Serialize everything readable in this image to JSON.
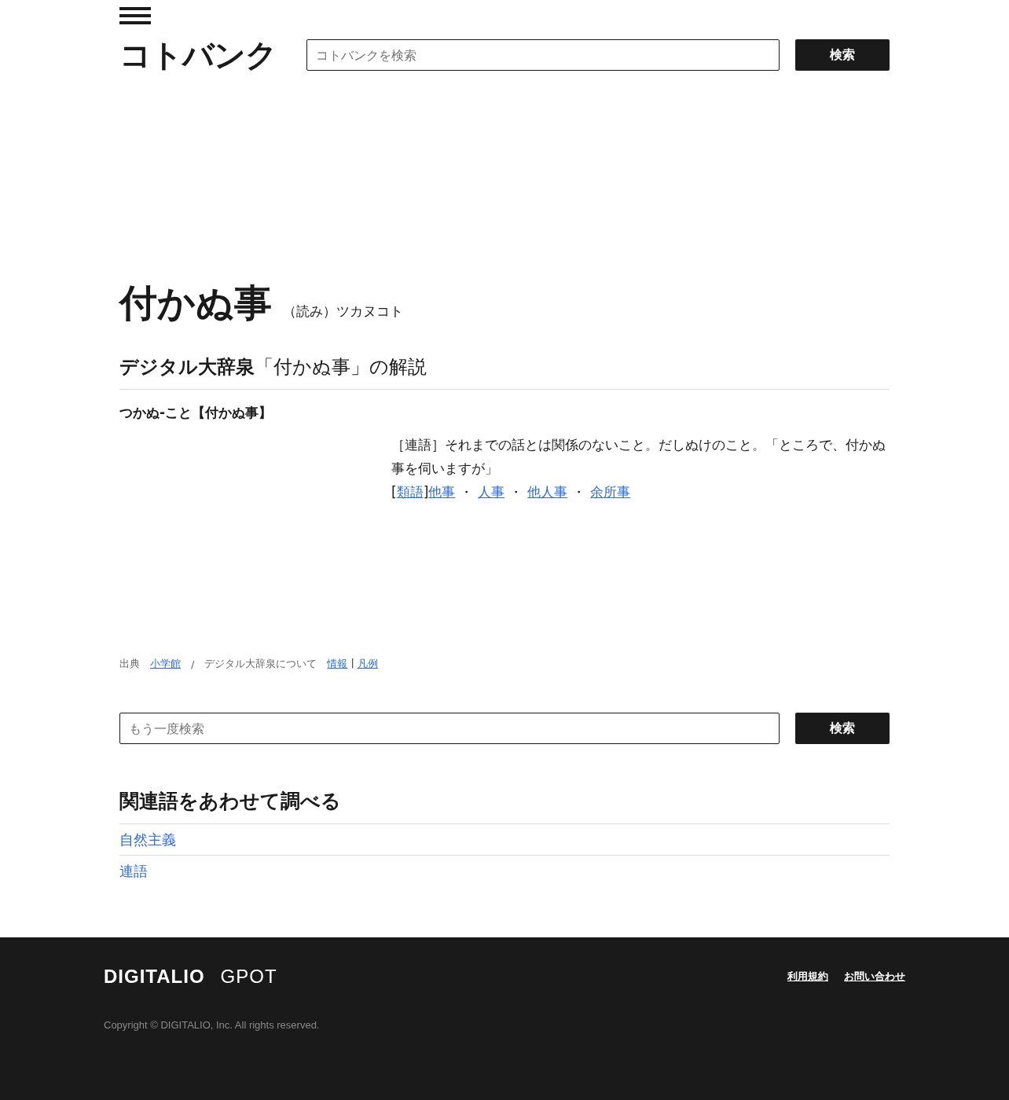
{
  "header": {
    "logo": "コトバンク",
    "search": {
      "placeholder": "コトバンクを検索"
    },
    "search_button": "検索"
  },
  "entry": {
    "title": "付かぬ事",
    "reading": "（読み）ツカヌコト"
  },
  "section": {
    "source_name": "デジタル大辞泉",
    "heading_rest": "「付かぬ事」の解説"
  },
  "definition": {
    "headword": "つかぬ-こと【付かぬ事】",
    "body": "［連語］それまでの話とは関係のないこと。だしぬけのこと。「ところで、付かぬ事を伺いますが」",
    "synonym_open": "[",
    "synonym_label": "類語",
    "synonym_close": "]",
    "synonyms": [
      "他事",
      "人事",
      "他人事",
      "余所事"
    ],
    "separator": "・"
  },
  "source_line": {
    "label": "出典",
    "publisher": "小学館",
    "slash": "/",
    "about": "デジタル大辞泉について",
    "info": "情報",
    "pipe": "|",
    "legend": "凡例"
  },
  "search_again": {
    "placeholder": "もう一度検索",
    "button": "検索"
  },
  "related": {
    "heading": "関連語をあわせて調べる",
    "items": [
      "自然主義",
      "連語"
    ]
  },
  "footer": {
    "logos": [
      "DIGITALIO",
      "GPOT"
    ],
    "links": [
      "利用規約",
      "お問い合わせ"
    ],
    "copyright": "Copyright © DIGITALIO, Inc. All rights reserved."
  }
}
